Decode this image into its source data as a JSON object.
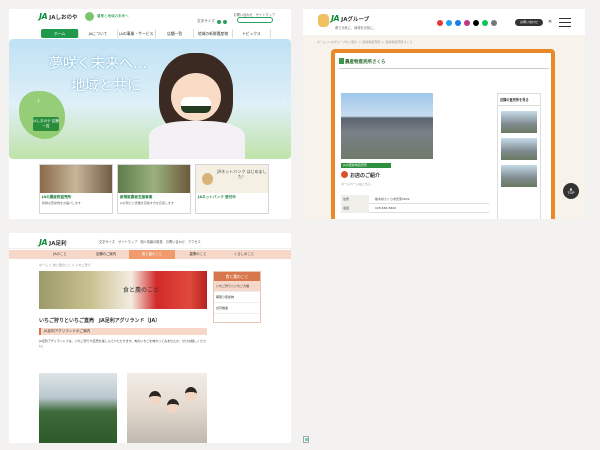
{
  "panel1": {
    "logo_ja": "JA",
    "logo_name": "JAしおのや",
    "tagline": "農業と地域の未来へ",
    "util": "お問い合わせ　サイトマップ",
    "fontsize_label": "文字サイズ",
    "nav": [
      "ホーム",
      "JAについて",
      "JAの事業・サービス",
      "店舗一覧",
      "地域の新鮮農産物",
      "トピックス"
    ],
    "hero": {
      "catch1": "夢咲く未来へ…",
      "catch2": "地域と共に",
      "map_badge": "JAしおのや 店舗一覧"
    },
    "cards": [
      {
        "title": "JAの農産物直売所",
        "desc": "新鮮な農産物をお届けします"
      },
      {
        "title": "新規就農者支援事業",
        "desc": "JAが新たに農業を目指す方を応援します"
      },
      {
        "title": "JAネットバンク 受付中",
        "desc": "",
        "mini": "JAネットバンク はじめました！"
      }
    ]
  },
  "panel2": {
    "logo_ja": "JA",
    "logo_name": "JAグループ",
    "subtitle": "食で元気に、地域を元気に。",
    "contact": "お問い合わせ",
    "breadcrumb": "ホーム ＞ JAグループのご紹介 ＞ 農産物直売所 ＞ 農産物直売所さくら",
    "store_title": "農産物直売所さくら",
    "green_label": "JAの農産物直売所",
    "intro": "お店のご紹介",
    "small": "ホームページはこちら",
    "table": [
      {
        "k": "住所",
        "v": "栃木県さくら市氏家2652"
      },
      {
        "k": "電話",
        "v": "028-682-8490"
      }
    ],
    "side_heading": "近隣の直売所を見る",
    "top": "TOP"
  },
  "panel3": {
    "logo_ja": "JA",
    "logo_name": "JA足利",
    "util": "文字サイズ　サイトマップ　個人情報の取扱　お問い合わせ　アクセス",
    "nav": [
      "JAのこと",
      "店舗のご案内",
      "食と農のこと",
      "農業のこと",
      "くらしのこと"
    ],
    "breadcrumb": "ホーム ＞ 食と農のこと ＞ いちご狩り",
    "banner_text": "食と農のこと",
    "side_heading": "食と農のこと",
    "side_items": [
      "いちご狩りといちご大福",
      "朝取り農産物",
      "食育推進"
    ],
    "heading": "いちご狩りといちご直売　JA足利アグリランド（JA）",
    "bar": "JA足利アグリランドのご案内",
    "para": "JA足利アグリランドでは、いちご狩りや直売を楽しんでいただけます。旬のいちごを味わってみませんか。ぜひお越しください。"
  },
  "colors": {
    "ja_green": "#0a8a3a",
    "orange": "#e88a2a",
    "pink": "#f6d7c8"
  }
}
